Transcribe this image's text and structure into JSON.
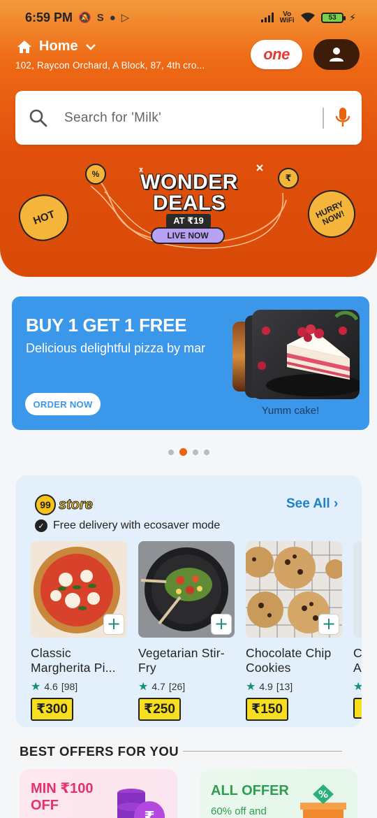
{
  "status_bar": {
    "time": "6:59 PM",
    "network_label": "Vo WiFi",
    "battery": "53"
  },
  "location": {
    "title": "Home",
    "address": "102, Raycon Orchard, A Block, 87, 4th cro..."
  },
  "header_buttons": {
    "one_label": "one"
  },
  "search": {
    "placeholder": "Search for 'Milk'"
  },
  "deals_banner": {
    "title": "WONDER DEALS",
    "price_tag": "AT ₹19",
    "live_label": "LIVE NOW",
    "hot_label": "HOT",
    "hurry_label": "HURRY NOW!"
  },
  "promo": {
    "title": "BUY 1 GET 1 FREE",
    "subtitle": "Delicious delightful pizza by mar",
    "cta": "ORDER NOW",
    "caption": "Yumm cake!",
    "carousel_dots": 4,
    "active_dot": 1
  },
  "store": {
    "logo_number": "99",
    "logo_text": "store",
    "see_all": "See All",
    "eco_text": "Free delivery with ecosaver mode",
    "products": [
      {
        "name": "Classic Margherita Pi...",
        "rating": "4.6",
        "reviews": "[98]",
        "price": "₹300"
      },
      {
        "name": "Vegetarian Stir-Fry",
        "rating": "4.7",
        "reviews": "[26]",
        "price": "₹250"
      },
      {
        "name": "Chocolate Chip Cookies",
        "rating": "4.9",
        "reviews": "[13]",
        "price": "₹150"
      },
      {
        "name": "C A",
        "rating": "",
        "reviews": "",
        "price": ""
      }
    ]
  },
  "best_offers": {
    "title": "BEST OFFERS FOR YOU",
    "offers": [
      {
        "title": "MIN ₹100 OFF",
        "subtitle": ""
      },
      {
        "title": "ALL OFFER",
        "subtitle": "60% off and"
      }
    ]
  },
  "colors": {
    "brand_orange": "#e0500c",
    "promo_blue": "#3b97ea",
    "price_yellow": "#f7de1f",
    "rating_green": "#1a8c7a"
  }
}
